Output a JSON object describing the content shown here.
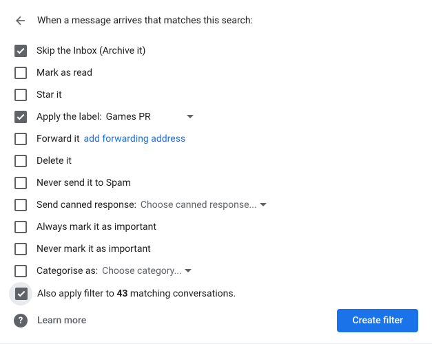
{
  "header": {
    "title": "When a message arrives that matches this search:"
  },
  "options": {
    "skip_inbox": "Skip the Inbox (Archive it)",
    "mark_read": "Mark as read",
    "star_it": "Star it",
    "apply_label_prefix": "Apply the label:",
    "apply_label_value": "Games PR",
    "forward_it": "Forward it",
    "forward_link": "add forwarding address",
    "delete_it": "Delete it",
    "never_spam": "Never send it to Spam",
    "canned_prefix": "Send canned response:",
    "canned_value": "Choose canned response...",
    "always_important": "Always mark it as important",
    "never_important": "Never mark it as important",
    "categorise_prefix": "Categorise as:",
    "categorise_value": "Choose category...",
    "also_apply_prefix": "Also apply filter to ",
    "also_apply_count": "43",
    "also_apply_suffix": " matching conversations."
  },
  "footer": {
    "learn_more": "Learn more",
    "create_button": "Create filter"
  }
}
